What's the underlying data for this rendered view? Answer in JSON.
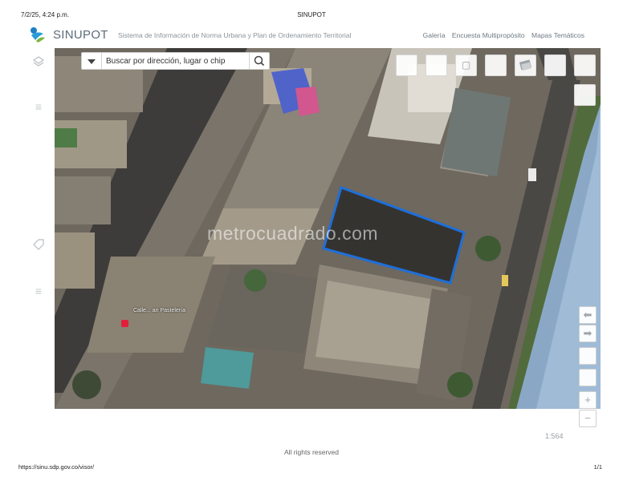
{
  "print_header": {
    "date": "7/2/25, 4:24 p.m.",
    "title": "SINUPOT"
  },
  "app": {
    "brand": "SINUPOT",
    "subtitle": "Sistema de Información de Norma Urbana y Plan de Ordenamiento Territorial",
    "nav": [
      "Galería",
      "Encuesta Multipropósito",
      "Mapas Temáticos"
    ]
  },
  "search": {
    "placeholder": "Buscar por dirección, lugar o chip"
  },
  "map": {
    "watermark": "metrocuadrado.com",
    "poi_label": "Calle... an Pastelería",
    "scale": "1:564",
    "parcel_color": "#1e6fd9"
  },
  "footer": {
    "rights": "All rights reserved",
    "url": "https://sinu.sdp.gov.co/visor/",
    "page": "1/1"
  }
}
